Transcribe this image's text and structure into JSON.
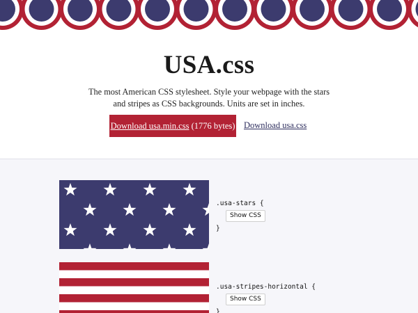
{
  "header": {
    "title": "USA.css",
    "tagline": "The most American CSS stylesheet. Style your webpage with the stars and stripes as CSS backgrounds. Units are set in inches.",
    "download_min_link": "Download usa.min.css",
    "download_min_size": "(1776 bytes)",
    "download_full": "Download usa.css"
  },
  "examples": [
    {
      "selector_open": ".usa-stars {",
      "button": "Show CSS",
      "selector_close": "}"
    },
    {
      "selector_open": ".usa-stripes-horizontal {",
      "button": "Show CSS",
      "selector_close": "}"
    }
  ],
  "colors": {
    "red": "#b22234",
    "blue": "#3c3b6e",
    "white": "#ffffff",
    "section_bg": "#f6f6fa"
  }
}
